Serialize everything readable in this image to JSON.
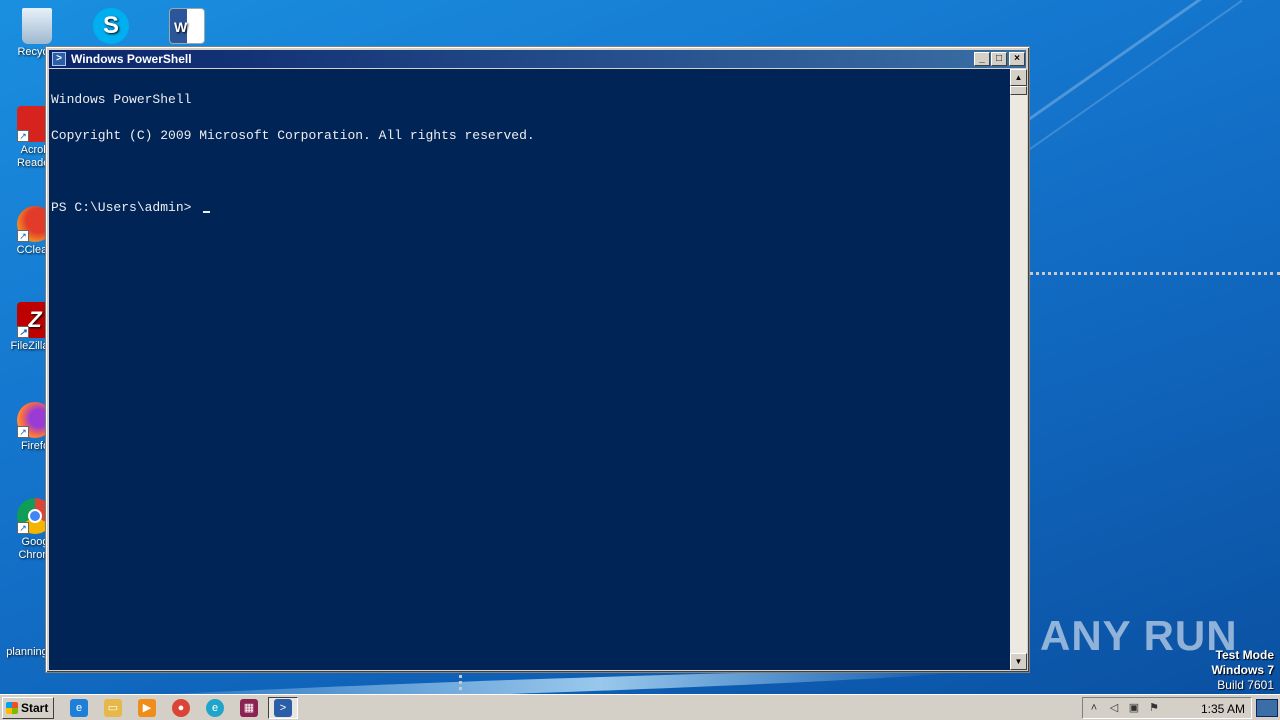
{
  "desktop": {
    "icons": [
      {
        "label": "Recycle",
        "icon": "recycle-bin-icon"
      },
      {
        "label": "Acrob\nReader",
        "icon": "acrobat-reader-icon"
      },
      {
        "label": "CClean",
        "icon": "ccleaner-icon"
      },
      {
        "label": "FileZilla C",
        "icon": "filezilla-icon"
      },
      {
        "label": "Firefo",
        "icon": "firefox-icon"
      },
      {
        "label": "Goog\nChrom",
        "icon": "chrome-icon"
      },
      {
        "label": "planning",
        "icon": "document-icon"
      }
    ],
    "top_icons": [
      {
        "icon": "skype-icon",
        "letter": "S"
      },
      {
        "icon": "word-document-icon",
        "letter": "W"
      }
    ],
    "watermark": "ANY RUN",
    "test_mode": {
      "line1": "Test Mode",
      "line2": "Windows 7",
      "line3": "Build 7601"
    }
  },
  "window": {
    "title": "Windows PowerShell",
    "console_lines": [
      "Windows PowerShell",
      "Copyright (C) 2009 Microsoft Corporation. All rights reserved.",
      "",
      "PS C:\\Users\\admin> "
    ],
    "buttons": {
      "minimize": "_",
      "maximize": "□",
      "close": "×"
    }
  },
  "taskbar": {
    "start_label": "Start",
    "clock": "1:35 AM",
    "pinned": [
      {
        "icon": "internet-explorer-icon",
        "glyph": "e",
        "color": "#1e7fd8"
      },
      {
        "icon": "explorer-folder-icon",
        "glyph": "▭",
        "color": "#e6b84a"
      },
      {
        "icon": "media-player-icon",
        "glyph": "▶",
        "color": "#f08c1a"
      },
      {
        "icon": "chrome-icon",
        "glyph": "●",
        "color": "#db4437"
      },
      {
        "icon": "edge-icon",
        "glyph": "e",
        "color": "#1fa5c9"
      },
      {
        "icon": "winrar-icon",
        "glyph": "▦",
        "color": "#8b2252"
      },
      {
        "icon": "powershell-icon",
        "glyph": ">",
        "color": "#2b5ea8"
      }
    ]
  }
}
